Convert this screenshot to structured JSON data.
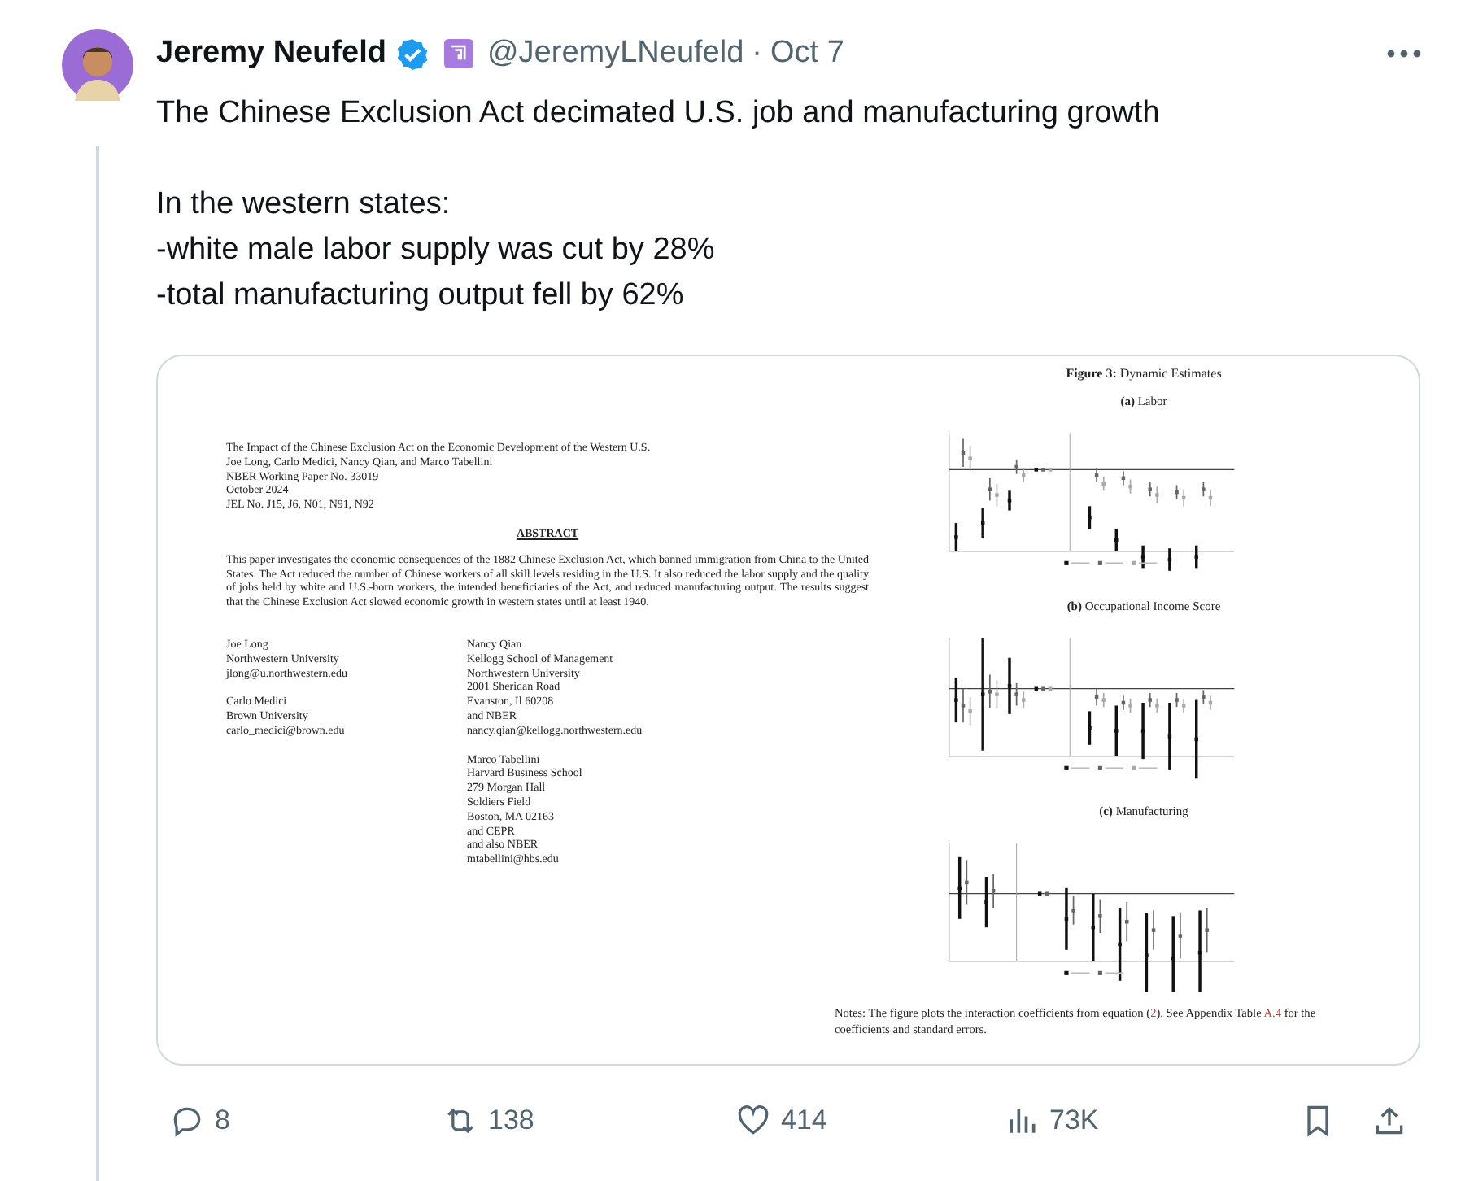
{
  "author": {
    "name": "Jeremy Neufeld",
    "verified": true,
    "handle": "@JeremyLNeufeld",
    "separator": "·",
    "date": "Oct 7"
  },
  "paragraphs": [
    [
      "The Chinese Exclusion Act decimated U.S. job and manufacturing growth"
    ],
    [
      "In the western states:",
      "-white male labor supply was cut by 28%",
      "-total manufacturing output fell by 62%"
    ]
  ],
  "paper": {
    "header_lines": [
      "The Impact of the Chinese Exclusion Act on the Economic Development of the Western U.S.",
      "Joe Long, Carlo Medici, Nancy Qian, and Marco Tabellini",
      "NBER Working Paper No. 33019",
      "October 2024",
      "JEL No. J15, J6, N01, N91, N92"
    ],
    "abstract_heading": "ABSTRACT",
    "abstract": "This paper investigates the economic consequences of the 1882 Chinese Exclusion Act, which banned immigration from China to the United States. The Act reduced the number of Chinese workers of all skill levels residing in the U.S. It also reduced the labor supply and the quality of jobs held by white and U.S.-born workers, the intended beneficiaries of the Act, and reduced manufacturing output. The results suggest that the Chinese Exclusion Act slowed economic growth in western states until at least 1940.",
    "authors_left": [
      [
        "Joe Long",
        "Northwestern University",
        "jlong@u.northwestern.edu"
      ],
      [
        "Carlo Medici",
        "Brown University",
        "carlo_medici@brown.edu"
      ]
    ],
    "authors_right": [
      [
        "Nancy Qian",
        "Kellogg School of Management",
        "Northwestern University",
        "2001 Sheridan Road",
        "Evanston, Il 60208",
        "and NBER",
        "nancy.qian@kellogg.northwestern.edu"
      ],
      [
        "Marco Tabellini",
        "Harvard Business School",
        "279 Morgan Hall",
        "Soldiers Field",
        "Boston, MA 02163",
        "and CEPR",
        "and also NBER",
        "mtabellini@hbs.edu"
      ]
    ]
  },
  "figure": {
    "title": "**Figure 3:** Dynamic Estimates",
    "panels": [
      {
        "title": "**(a)** Labor",
        "kind": "labor"
      },
      {
        "title": "**(b)** Occupational Income Score",
        "kind": "income"
      },
      {
        "title": "**(c)** Manufacturing",
        "kind": "manufacturing"
      }
    ],
    "notes": [
      {
        "text": "Notes: The figure plots the interaction coefficients from equation (",
        "link": false
      },
      {
        "text": "2",
        "link": true
      },
      {
        "text": ").  See Appendix Table ",
        "link": false
      },
      {
        "text": "A.4",
        "link": true
      },
      {
        "text": " for the coefficients and standard errors.",
        "link": false
      }
    ]
  },
  "actions": [
    {
      "kind": "reply",
      "count": "8"
    },
    {
      "kind": "repost",
      "count": "138"
    },
    {
      "kind": "like",
      "count": "414"
    },
    {
      "kind": "views",
      "count": "73K"
    },
    {
      "kind": "bookmark"
    },
    {
      "kind": "share"
    }
  ]
}
